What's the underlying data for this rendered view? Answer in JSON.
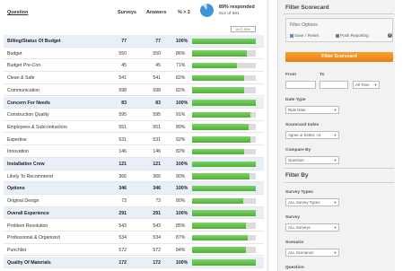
{
  "table": {
    "headers": {
      "question": "Question",
      "surveys": "Surveys",
      "answers": "Answers",
      "pct": "% > 2"
    },
    "response": {
      "percent": 0.89,
      "main": "89% responded",
      "sub": "612 of 661"
    },
    "avg_button": "AVG 89%",
    "rows": [
      {
        "question": "Billing/Status Of Budget",
        "surveys": "77",
        "answers": "77",
        "pct": "100%",
        "fill": 1.0,
        "group": true
      },
      {
        "question": "Budget",
        "surveys": "550",
        "answers": "550",
        "pct": "86%",
        "fill": 0.86,
        "group": false
      },
      {
        "question": "Budget Pre-Con",
        "surveys": "45",
        "answers": "45",
        "pct": "71%",
        "fill": 0.71,
        "group": false
      },
      {
        "question": "Clean & Safe",
        "surveys": "541",
        "answers": "541",
        "pct": "82%",
        "fill": 0.82,
        "group": false
      },
      {
        "question": "Communication",
        "surveys": "598",
        "answers": "598",
        "pct": "82%",
        "fill": 0.82,
        "group": false
      },
      {
        "question": "Concern For Needs",
        "surveys": "83",
        "answers": "83",
        "pct": "100%",
        "fill": 1.0,
        "group": true
      },
      {
        "question": "Construction Quality",
        "surveys": "595",
        "answers": "595",
        "pct": "91%",
        "fill": 0.91,
        "group": false
      },
      {
        "question": "Employees & Subcontractors",
        "surveys": "551",
        "answers": "551",
        "pct": "89%",
        "fill": 0.89,
        "group": false
      },
      {
        "question": "Expertise",
        "surveys": "531",
        "answers": "531",
        "pct": "92%",
        "fill": 0.92,
        "group": false
      },
      {
        "question": "Innovation",
        "surveys": "146",
        "answers": "146",
        "pct": "82%",
        "fill": 0.82,
        "group": false
      },
      {
        "question": "Installation Crew",
        "surveys": "121",
        "answers": "121",
        "pct": "100%",
        "fill": 1.0,
        "group": true
      },
      {
        "question": "Likely To Recommend",
        "surveys": "366",
        "answers": "366",
        "pct": "90%",
        "fill": 0.9,
        "group": false
      },
      {
        "question": "Options",
        "surveys": "346",
        "answers": "346",
        "pct": "100%",
        "fill": 1.0,
        "group": true
      },
      {
        "question": "Original Design",
        "surveys": "73",
        "answers": "73",
        "pct": "80%",
        "fill": 0.8,
        "group": false
      },
      {
        "question": "Overall Experience",
        "surveys": "291",
        "answers": "291",
        "pct": "100%",
        "fill": 1.0,
        "group": true
      },
      {
        "question": "Problem Resolution",
        "surveys": "543",
        "answers": "543",
        "pct": "85%",
        "fill": 0.85,
        "group": false
      },
      {
        "question": "Professional & Organized",
        "surveys": "534",
        "answers": "534",
        "pct": "87%",
        "fill": 0.87,
        "group": false
      },
      {
        "question": "Punchlist",
        "surveys": "572",
        "answers": "572",
        "pct": "84%",
        "fill": 0.84,
        "group": false
      },
      {
        "question": "Quality Of Materials",
        "surveys": "172",
        "answers": "172",
        "pct": "100%",
        "fill": 1.0,
        "group": true
      }
    ]
  },
  "panel": {
    "title": "Filter Scorecard",
    "filter_options": {
      "title": "Filter Options",
      "save": "Save",
      "reset": "Reset",
      "push": "Push Reporting",
      "help": "?"
    },
    "filter_button": "Filter Scorecard",
    "from_label": "From",
    "to_label": "To",
    "time_select": "All Time",
    "date_type": {
      "label": "Date Type",
      "value": "Ride Date"
    },
    "scorecard_index": {
      "label": "Scorecard Index",
      "value": "Agree or better, >2"
    },
    "compare_by": {
      "label": "Compare By",
      "value": "Question"
    },
    "filter_by_title": "Filter By",
    "survey_types": {
      "label": "Survey Types",
      "value": "ALL Survey Types"
    },
    "survey": {
      "label": "Survey",
      "value": "ALL Surveys"
    },
    "scenario": {
      "label": "Scenario",
      "value": "ALL Scenarios"
    },
    "question_label": "Question"
  },
  "colors": {
    "accent_orange": "#ea7c10",
    "bar_green": "#4fb134",
    "pie_blue": "#3f94d8",
    "group_row_bg": "#e9eff7"
  }
}
